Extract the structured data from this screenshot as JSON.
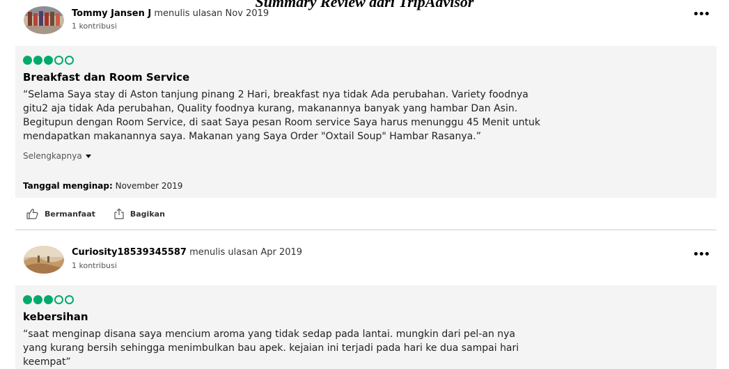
{
  "caption": "Summary Review dari TripAdvisor",
  "reviews": [
    {
      "author": "Tommy Jansen J",
      "wrote": "menulis ulasan Nov 2019",
      "contributions": "1 kontribusi",
      "rating_filled": 3,
      "rating_total": 5,
      "title": "Breakfast dan Room Service",
      "lines": [
        "“Selama Saya stay di Aston tanjung pinang 2 Hari, breakfast nya tidak Ada perubahan. Variety foodnya",
        "gitu2 aja tidak Ada perubahan, Quality foodnya kurang, makanannya banyak yang hambar Dan Asin.",
        "Begitupun dengan Room Service, di saat Saya pesan Room service Saya harus menunggu 45 Menit untuk",
        "mendapatkan makanannya saya. Makanan yang Saya Order \"Oxtail Soup\" Hambar Rasanya.”"
      ],
      "read_more": "Selengkapnya",
      "stay_label": "Tanggal menginap:",
      "stay_value": "November 2019",
      "helpful_label": "Bermanfaat",
      "share_label": "Bagikan"
    },
    {
      "author": "Curiosity18539345587",
      "wrote": "menulis ulasan Apr 2019",
      "contributions": "1 kontribusi",
      "rating_filled": 3,
      "rating_total": 5,
      "title": "kebersihan",
      "lines": [
        "“saat menginap disana saya mencium aroma yang tidak sedap pada lantai. mungkin dari pel-an nya",
        "yang kurang bersih sehingga menimbulkan bau apek. kejaian ini terjadi pada hari ke dua sampai hari",
        "keempat”"
      ]
    }
  ],
  "colors": {
    "rating_green": "#00aa6c",
    "panel_bg": "#f4f4f4"
  },
  "icons": {
    "more": "more-dots-icon",
    "helpful": "thumbs-up-icon",
    "share": "share-icon"
  }
}
